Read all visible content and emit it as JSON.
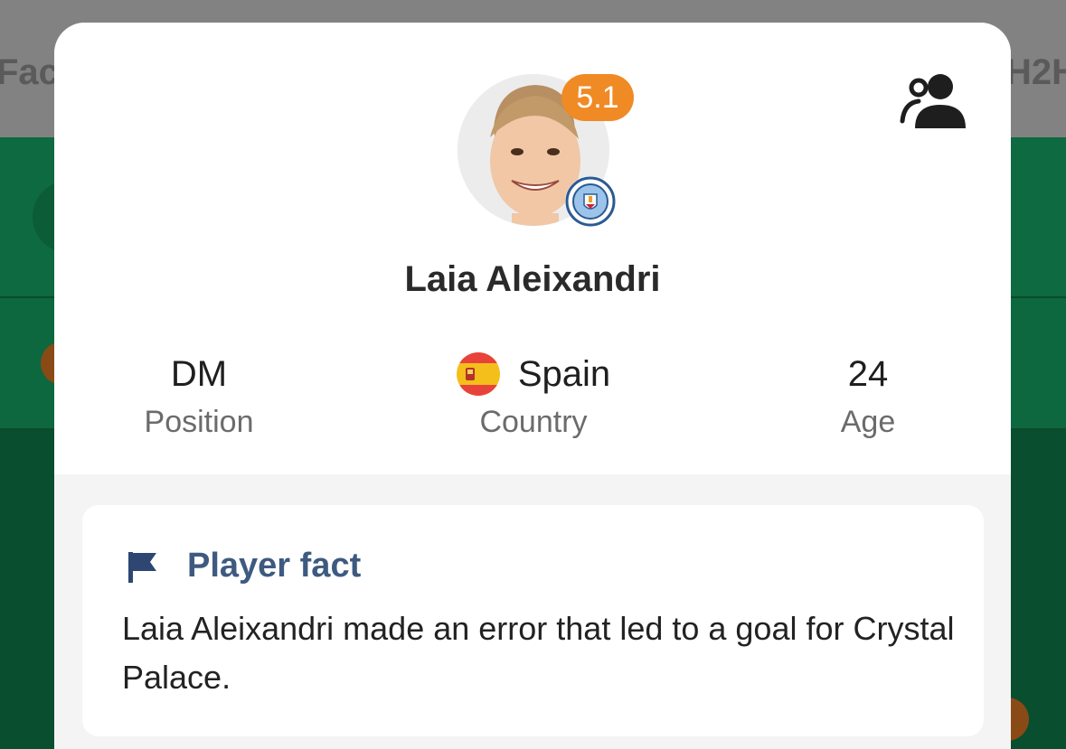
{
  "background": {
    "tab_left_label": "Fact",
    "tab_right_label": "H2H"
  },
  "player": {
    "name": "Laia Aleixandri",
    "rating": "5.1",
    "club_icon": "manchester-city-crest-icon"
  },
  "stats": {
    "position": {
      "value": "DM",
      "label": "Position"
    },
    "country": {
      "value": "Spain",
      "label": "Country",
      "flag_icon": "spain-flag-icon"
    },
    "age": {
      "value": "24",
      "label": "Age"
    }
  },
  "fact": {
    "title": "Player fact",
    "text": "Laia Aleixandri made an error that led to a goal for Crystal Palace.",
    "icon": "flag-icon"
  },
  "colors": {
    "rating_badge": "#f08a24",
    "fact_title": "#3e5a80",
    "app_green": "#0e6a40"
  }
}
